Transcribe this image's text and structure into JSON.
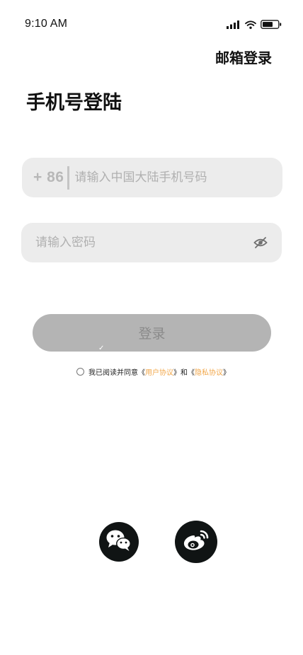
{
  "status_bar": {
    "time": "9:10 AM",
    "icons": [
      "signal-icon",
      "wifi-icon",
      "battery-icon"
    ]
  },
  "header": {
    "email_login_label": "邮箱登录"
  },
  "page": {
    "title": "手机号登陆"
  },
  "phone": {
    "country_code": "+ 86",
    "placeholder": "请输入中国大陆手机号码",
    "value": ""
  },
  "password": {
    "placeholder": "请输入密码",
    "value": "",
    "toggle_icon": "eye-off-icon"
  },
  "login": {
    "button_label": "登录"
  },
  "agreement": {
    "prefix": "我已阅读并同意《",
    "user_agreement": "用户协议",
    "middle": "》和《",
    "privacy_policy": "隐私协议",
    "suffix": "》",
    "checked": false
  },
  "social": {
    "wechat_icon": "wechat-icon",
    "weibo_icon": "weibo-icon"
  },
  "colors": {
    "accent_link": "#f2a74a",
    "button_disabled": "#b4b4b4",
    "field_background": "#ececec",
    "social_background": "#101414"
  }
}
